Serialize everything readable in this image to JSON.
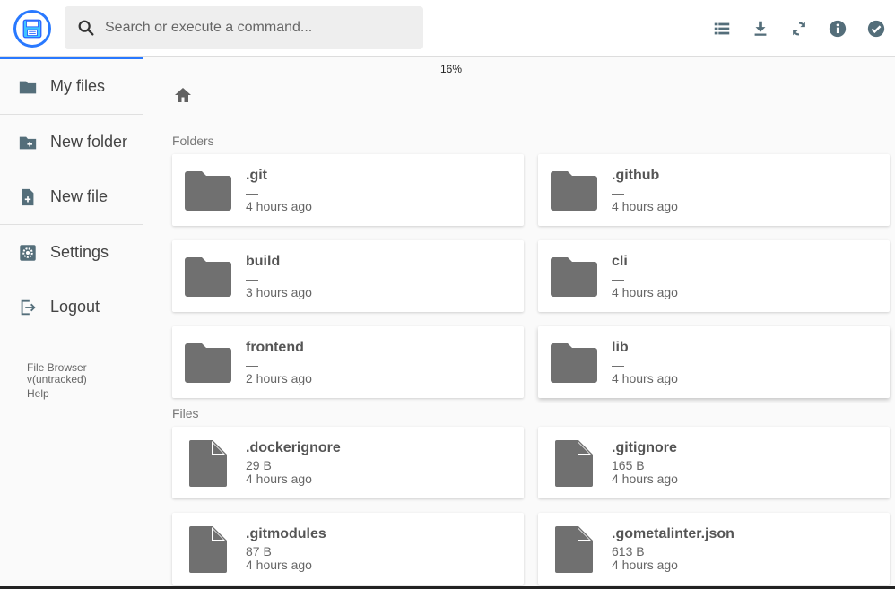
{
  "search": {
    "placeholder": "Search or execute a command..."
  },
  "header": {
    "actions": [
      "list-view-icon",
      "download-icon",
      "refresh-icon",
      "info-icon",
      "check-circle-icon"
    ]
  },
  "progress": {
    "text": "16%",
    "value": 0.16
  },
  "sidebar": {
    "items": [
      {
        "label": "My files",
        "icon": "folder-icon"
      },
      {
        "label": "New folder",
        "icon": "create-new-folder-icon"
      },
      {
        "label": "New file",
        "icon": "note-add-icon"
      },
      {
        "label": "Settings",
        "icon": "settings-icon"
      },
      {
        "label": "Logout",
        "icon": "logout-icon"
      }
    ],
    "footer": {
      "app_name": "File Browser",
      "version": "v(untracked)",
      "help": "Help"
    }
  },
  "main": {
    "folders_label": "Folders",
    "files_label": "Files",
    "folders": [
      {
        "name": ".git",
        "size": "—",
        "modified": "4 hours ago"
      },
      {
        "name": ".github",
        "size": "—",
        "modified": "4 hours ago"
      },
      {
        "name": "build",
        "size": "—",
        "modified": "3 hours ago"
      },
      {
        "name": "cli",
        "size": "—",
        "modified": "4 hours ago"
      },
      {
        "name": "frontend",
        "size": "—",
        "modified": "2 hours ago"
      },
      {
        "name": "lib",
        "size": "—",
        "modified": "4 hours ago"
      }
    ],
    "files": [
      {
        "name": ".dockerignore",
        "size": "29 B",
        "modified": "4 hours ago"
      },
      {
        "name": ".gitignore",
        "size": "165 B",
        "modified": "4 hours ago"
      },
      {
        "name": ".gitmodules",
        "size": "87 B",
        "modified": "4 hours ago"
      },
      {
        "name": ".gometalinter.json",
        "size": "613 B",
        "modified": "4 hours ago"
      }
    ]
  },
  "colors": {
    "accent": "#2979ff",
    "icon": "#546e7a",
    "file_icon": "#707070"
  }
}
